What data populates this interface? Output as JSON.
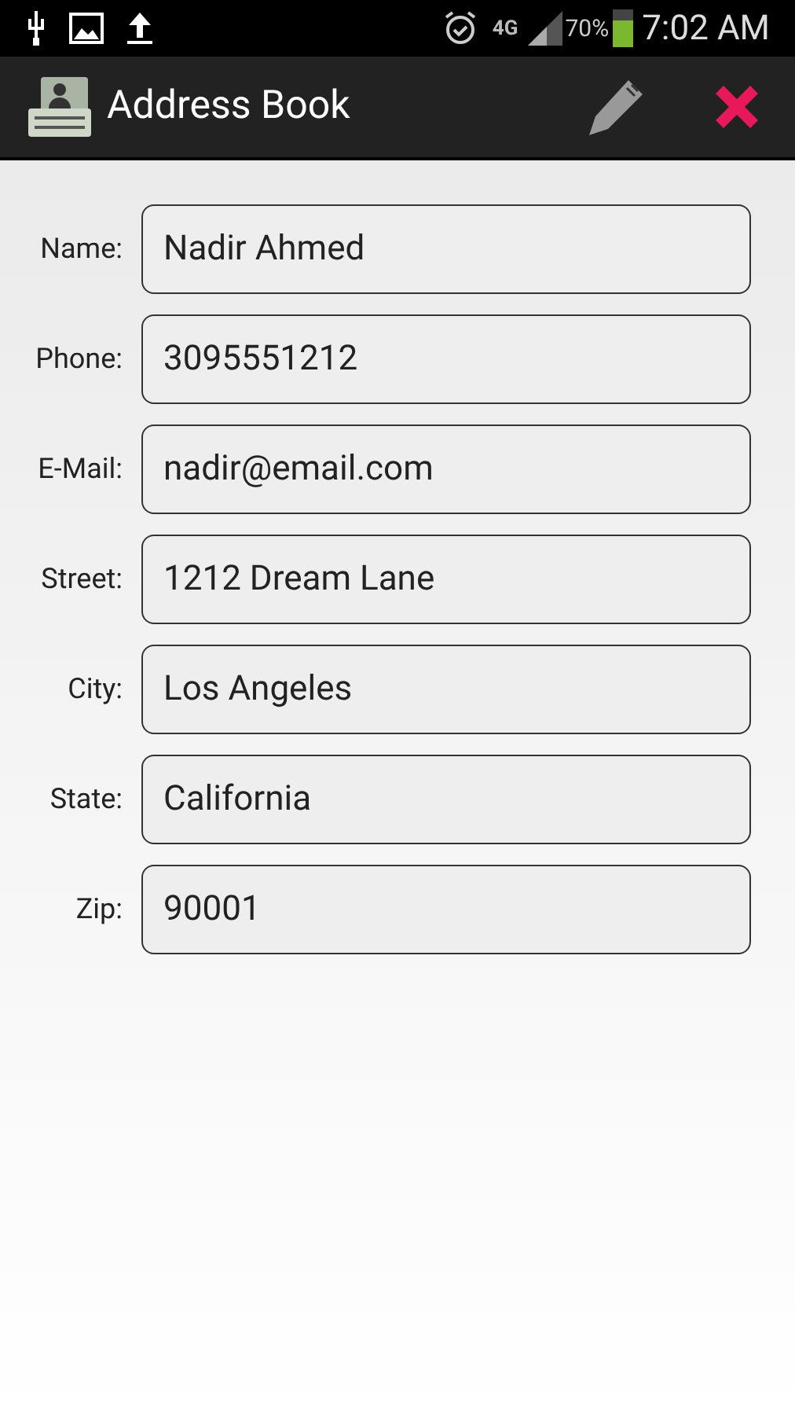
{
  "status_bar": {
    "network": "4G",
    "battery_text": "70%",
    "time": "7:02 AM"
  },
  "action_bar": {
    "title": "Address Book"
  },
  "fields": [
    {
      "label": "Name:",
      "value": "Nadir Ahmed"
    },
    {
      "label": "Phone:",
      "value": "3095551212"
    },
    {
      "label": "E-Mail:",
      "value": "nadir@email.com"
    },
    {
      "label": "Street:",
      "value": "1212 Dream Lane"
    },
    {
      "label": "City:",
      "value": "Los Angeles"
    },
    {
      "label": "State:",
      "value": "California"
    },
    {
      "label": "Zip:",
      "value": "90001"
    }
  ]
}
